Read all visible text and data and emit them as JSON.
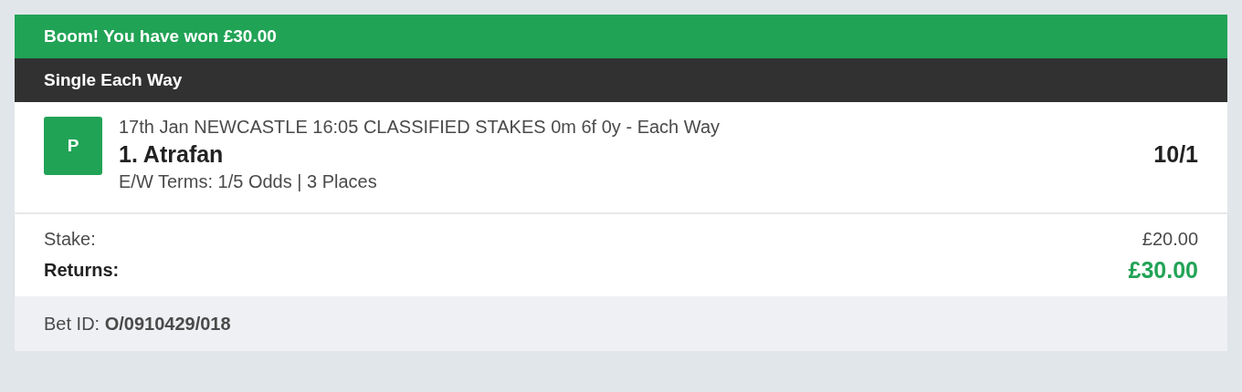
{
  "banner": {
    "title": "Boom! You have won £30.00"
  },
  "bet_type": {
    "title": "Single Each Way"
  },
  "selection": {
    "badge": "P",
    "race": "17th Jan NEWCASTLE 16:05 CLASSIFIED STAKES 0m 6f 0y - Each Way",
    "runner": "1. Atrafan",
    "terms": "E/W Terms: 1/5 Odds | 3 Places",
    "odds": "10/1"
  },
  "summary": [
    {
      "label": "Stake:",
      "value": "£20.00",
      "kind": "plain"
    },
    {
      "label": "Returns:",
      "value": "£30.00",
      "kind": "returns"
    }
  ],
  "footer": {
    "bet_id": "Bet ID: **O/0910429/018**"
  }
}
